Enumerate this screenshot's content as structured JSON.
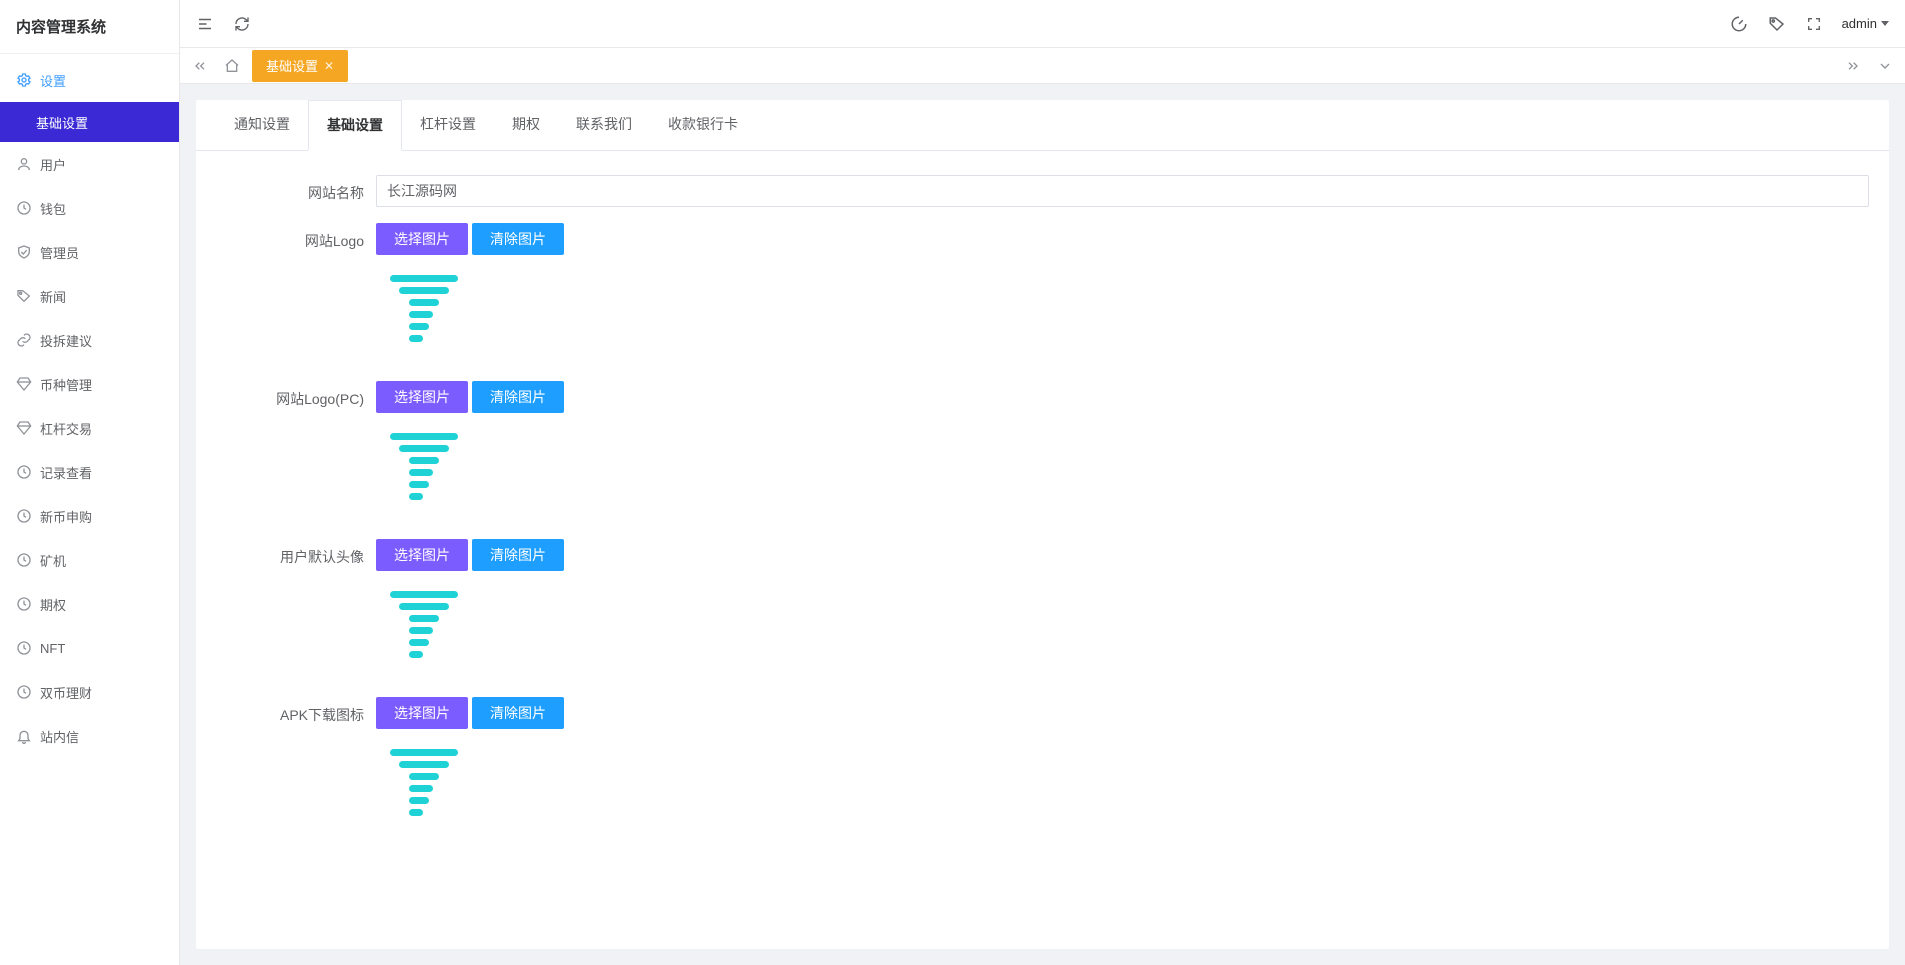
{
  "brand": {
    "title": "内容管理系统"
  },
  "sidebar": {
    "items": [
      {
        "label": "设置",
        "icon": "gear",
        "active_group": true
      },
      {
        "label": "基础设置",
        "is_submenu": true,
        "active": true
      },
      {
        "label": "用户",
        "icon": "user"
      },
      {
        "label": "钱包",
        "icon": "wallet"
      },
      {
        "label": "管理员",
        "icon": "shield"
      },
      {
        "label": "新闻",
        "icon": "tag"
      },
      {
        "label": "投拆建议",
        "icon": "link"
      },
      {
        "label": "币种管理",
        "icon": "diamond"
      },
      {
        "label": "杠杆交易",
        "icon": "diamond"
      },
      {
        "label": "记录查看",
        "icon": "clock"
      },
      {
        "label": "新币申购",
        "icon": "wallet"
      },
      {
        "label": "矿机",
        "icon": "clock"
      },
      {
        "label": "期权",
        "icon": "clock"
      },
      {
        "label": "NFT",
        "icon": "clock"
      },
      {
        "label": "双币理财",
        "icon": "clock"
      },
      {
        "label": "站内信",
        "icon": "bell"
      }
    ]
  },
  "header": {
    "user_label": "admin"
  },
  "pagetabs": {
    "tabs": [
      {
        "label": "基础设置",
        "active": true
      }
    ]
  },
  "form_tabs": {
    "items": [
      {
        "label": "通知设置"
      },
      {
        "label": "基础设置",
        "active": true
      },
      {
        "label": "杠杆设置"
      },
      {
        "label": "期权"
      },
      {
        "label": "联系我们"
      },
      {
        "label": "收款银行卡"
      }
    ]
  },
  "form": {
    "site_name_label": "网站名称",
    "site_name_value": "长江源码网",
    "select_btn": "选择图片",
    "clear_btn": "清除图片",
    "fields": [
      {
        "label": "网站Logo"
      },
      {
        "label": "网站Logo(PC)"
      },
      {
        "label": "用户默认头像"
      },
      {
        "label": "APK下载图标"
      }
    ]
  }
}
